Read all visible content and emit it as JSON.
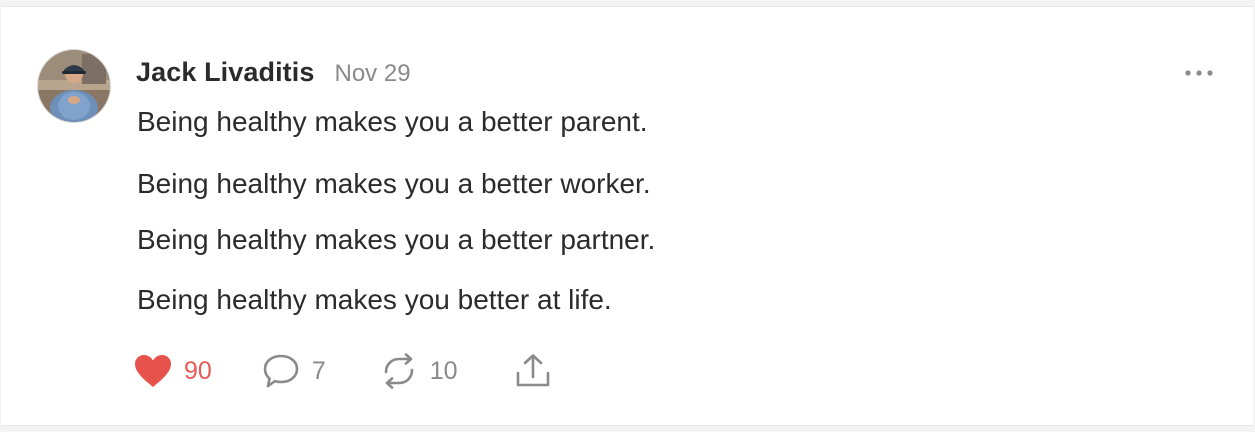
{
  "post": {
    "author": "Jack Livaditis",
    "date": "Nov 29",
    "lines": [
      "Being healthy makes you a better parent.",
      "Being healthy makes you a better worker.",
      "Being healthy makes you a better partner.",
      "Being healthy makes you better at life."
    ]
  },
  "actions": {
    "likes": "90",
    "comments": "7",
    "restacks": "10"
  },
  "icons": {
    "like": "heart-icon",
    "comment": "comment-bubble-icon",
    "restack": "restack-arrows-icon",
    "share": "share-upload-icon",
    "more": "more-dots-icon"
  },
  "colors": {
    "like_red": "#e8524d",
    "text": "#2b2b2b",
    "muted": "#8a8a8a"
  }
}
